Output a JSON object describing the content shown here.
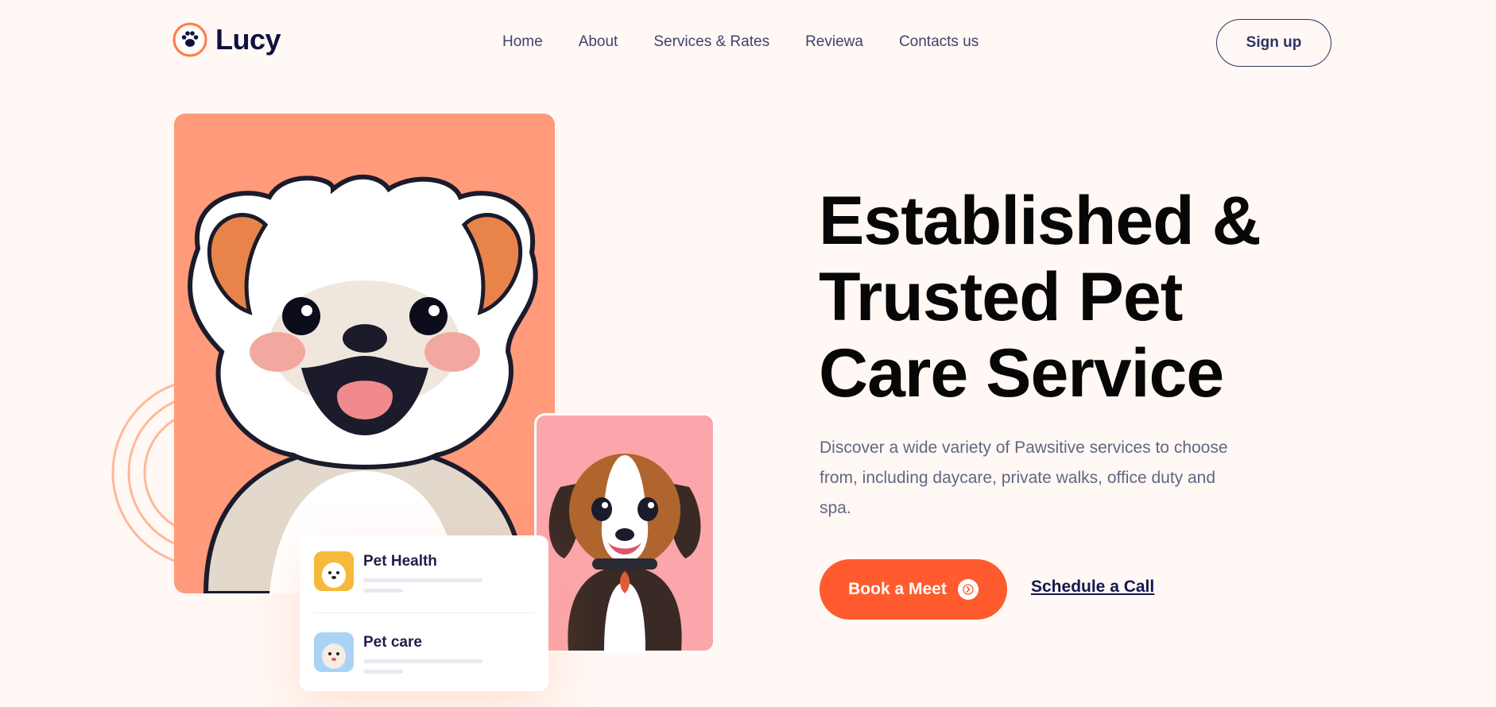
{
  "brand": {
    "name": "Lucy",
    "logo_icon": "paw-icon"
  },
  "nav": {
    "items": [
      {
        "label": "Home"
      },
      {
        "label": "About"
      },
      {
        "label": "Services & Rates"
      },
      {
        "label": "Reviewa"
      },
      {
        "label": "Contacts us"
      }
    ],
    "signup_label": "Sign up"
  },
  "hero": {
    "headline": [
      "Established &",
      "Trusted Pet",
      "Care Service"
    ],
    "description": "Discover a wide variety of Pawsitive services to choose from, including daycare, private walks, office duty and spa.",
    "cta_label": "Book a Meet",
    "cta_icon": "chevron-right-icon",
    "secondary_label": "Schedule a Call"
  },
  "services": [
    {
      "title": "Pet Health",
      "thumb_color": "#f6b93b"
    },
    {
      "title": "Pet care",
      "thumb_color": "#a9d3f5"
    }
  ],
  "colors": {
    "accent": "#ff5b2e",
    "background": "#fff8f4",
    "primary_card": "#ff9a7a",
    "secondary_card": "#fba6ab",
    "navy": "#0f1040"
  }
}
